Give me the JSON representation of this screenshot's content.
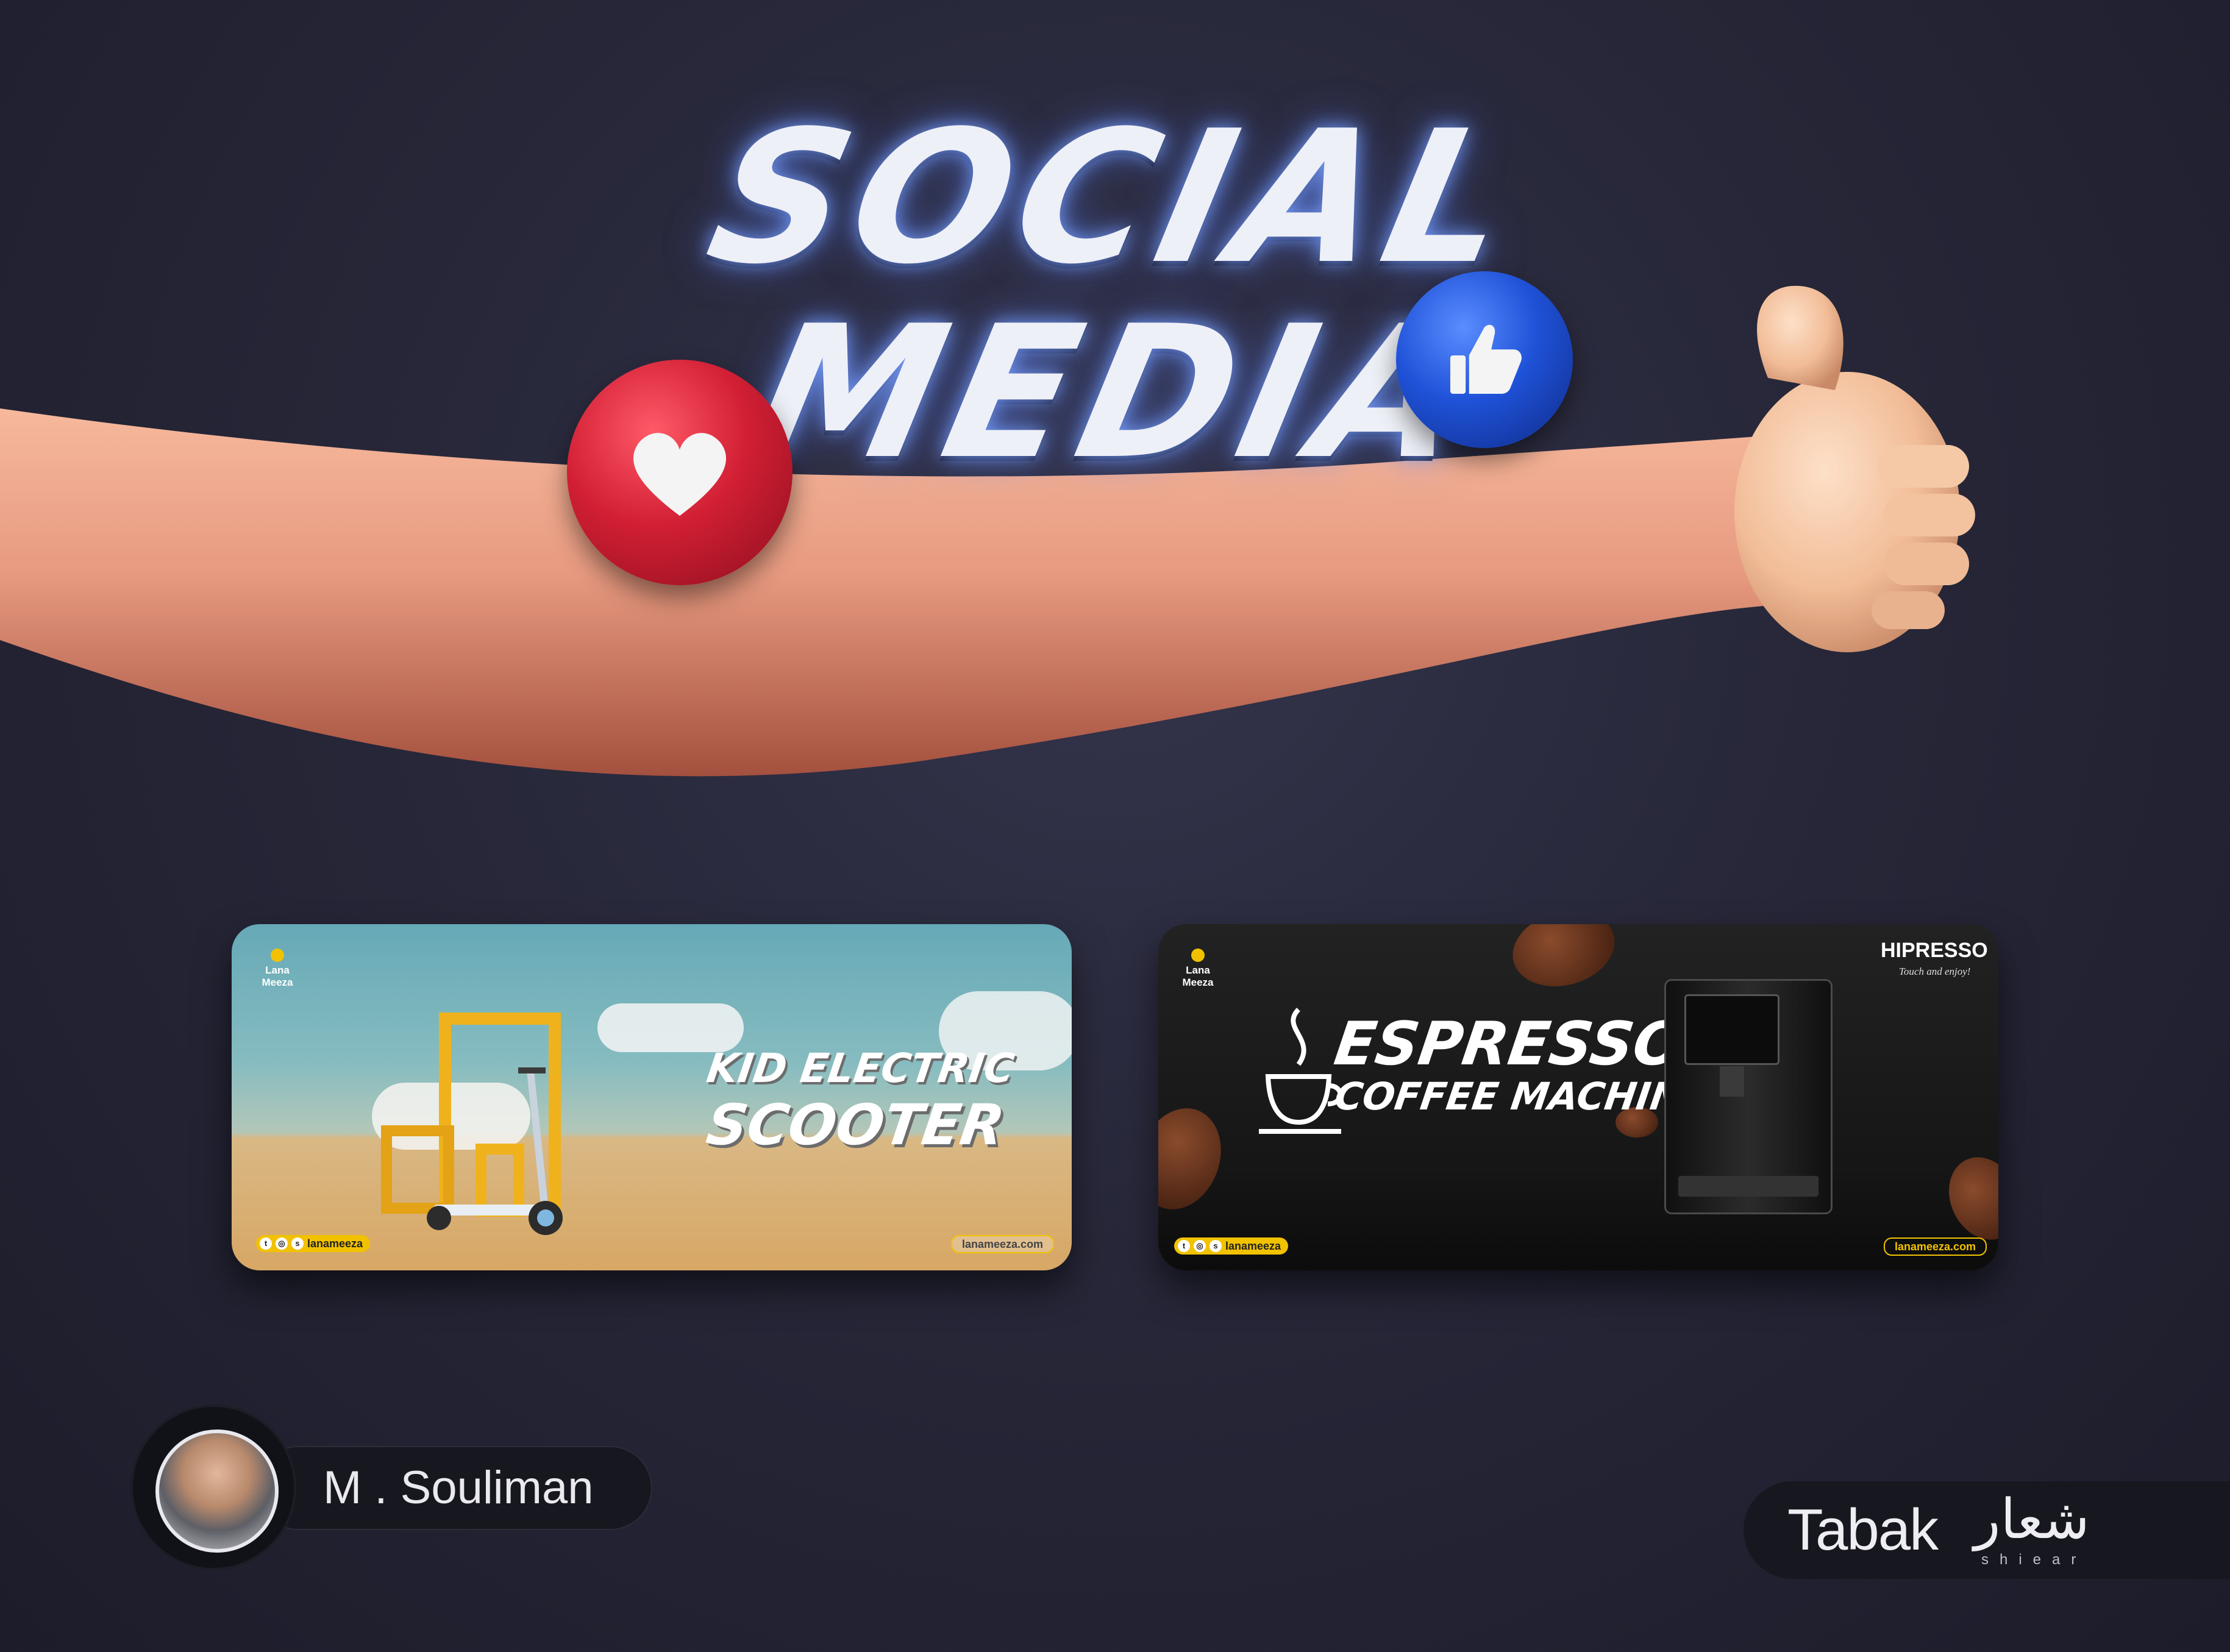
{
  "title": {
    "line1": "SOCIAL",
    "line2": "MEDIA"
  },
  "colors": {
    "background": "#272739",
    "title_glow": "#78a0ff",
    "heart_red": "#d21f34",
    "like_blue": "#1f52d8",
    "accent_yellow": "#f2c200"
  },
  "icons": {
    "heart": "heart-icon",
    "like": "thumbs-up-icon"
  },
  "cards": [
    {
      "brand_name": "Lana Meeza",
      "headline_line1": "KID ELECTRIC",
      "headline_line2": "SCOOTER",
      "social_handle": "lanameeza",
      "website": "lanameeza.com"
    },
    {
      "brand_name": "Lana Meeza",
      "partner_brand": "HIPRESSO",
      "partner_tagline": "Touch and enjoy!",
      "headline_line1": "ESPRESSO",
      "headline_line2": "COFFEE MACHINE",
      "social_handle": "lanameeza",
      "website": "lanameeza.com"
    }
  ],
  "author": {
    "name": "M . Souliman"
  },
  "agency": {
    "name": "Tabak",
    "partner_arabic": "شعار",
    "partner_latin": "shiear"
  }
}
